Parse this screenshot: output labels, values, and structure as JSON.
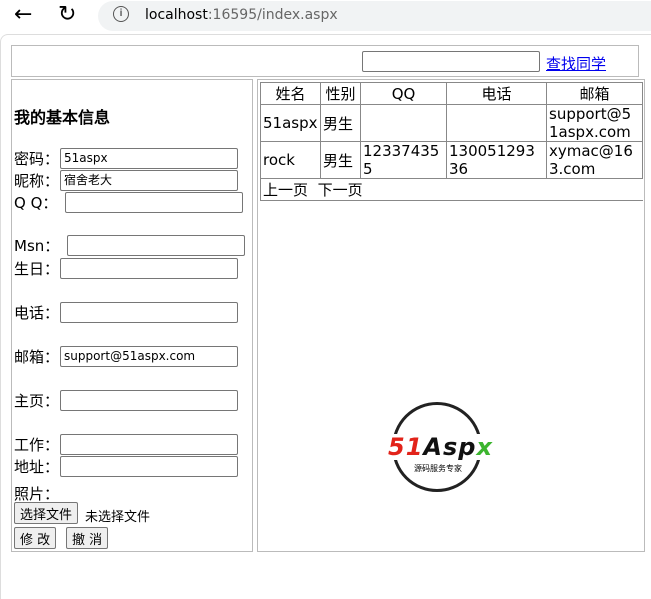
{
  "browser": {
    "url_host": "localhost",
    "url_rest": ":16595/index.aspx"
  },
  "search": {
    "value": "",
    "link": "查找同学"
  },
  "profile": {
    "title": "我的基本信息",
    "fields": [
      {
        "label": "密码：",
        "value": "51aspx"
      },
      {
        "label": "昵称：",
        "value": "宿舍老大"
      },
      {
        "label": "Q Q：",
        "value": ""
      },
      {
        "label": "Msn：",
        "value": ""
      },
      {
        "label": "生日：",
        "value": ""
      },
      {
        "label": "电话：",
        "value": ""
      },
      {
        "label": "邮箱：",
        "value": "support@51aspx.com"
      },
      {
        "label": "主页：",
        "value": ""
      },
      {
        "label": "工作：",
        "value": ""
      },
      {
        "label": "地址：",
        "value": ""
      }
    ],
    "photo_label": "照片：",
    "file_button": "选择文件",
    "file_status": "未选择文件",
    "modify": "修 改",
    "cancel": "撤 消"
  },
  "table": {
    "headers": [
      "姓名",
      "性别",
      "QQ",
      "电话",
      "邮箱"
    ],
    "rows": [
      [
        "51aspx",
        "男生",
        "",
        "",
        "support@51aspx.com"
      ],
      [
        "rock",
        "男生",
        "123374355",
        "13005129336",
        "xymac@163.com"
      ]
    ],
    "prev": "上一页",
    "next": "下一页"
  },
  "logo": {
    "brand_red": "51",
    "brand_black": "Asp",
    "brand_green": "x",
    "tagline": "源码服务专家"
  }
}
